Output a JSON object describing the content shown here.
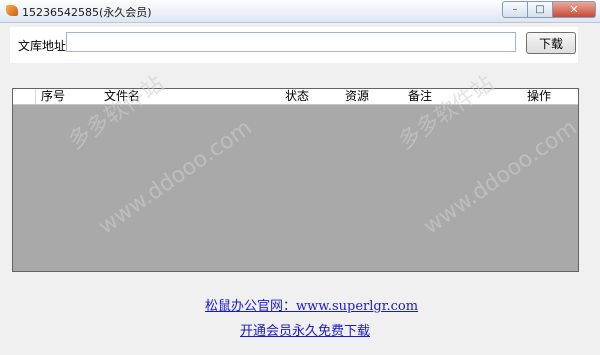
{
  "window": {
    "title": "15236542585(永久会员)",
    "min_symbol": "–",
    "max_symbol": "□",
    "close_symbol": "✕"
  },
  "form": {
    "url_label": "文库地址：",
    "url_value": "",
    "url_placeholder": "",
    "download_label": "下载"
  },
  "table": {
    "columns": [
      "序号",
      "文件名",
      "状态",
      "资源",
      "备注",
      "操作"
    ]
  },
  "watermark": {
    "text1": "多多软件站",
    "text2": "www.ddooo.com"
  },
  "links": {
    "official_site": "松鼠办公官网：www.superlgr.com",
    "membership": "开通会员永久免费下载"
  }
}
